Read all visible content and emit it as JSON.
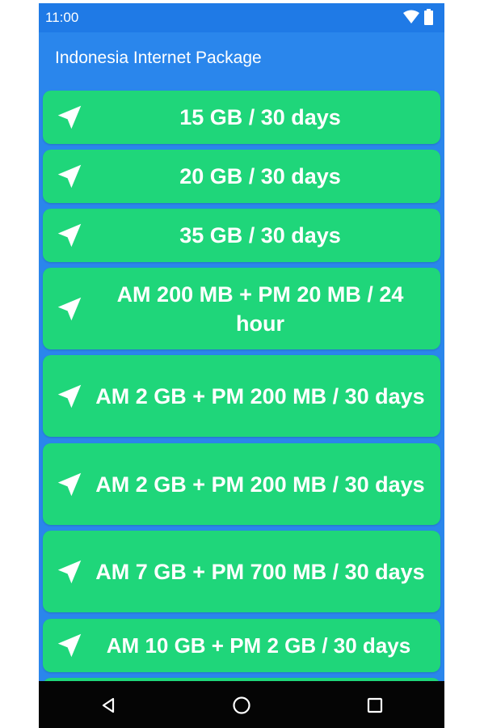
{
  "status_bar": {
    "time": "11:00",
    "icons": [
      "wifi-icon",
      "battery-icon"
    ]
  },
  "app_bar": {
    "title": "Indonesia Internet Package"
  },
  "packages": [
    {
      "label": "15 GB / 30 days"
    },
    {
      "label": "20 GB / 30 days"
    },
    {
      "label": "35 GB / 30 days"
    },
    {
      "label": "AM 200 MB + PM 20 MB / 24 hour"
    },
    {
      "label": "AM 2 GB + PM 200 MB / 30 days"
    },
    {
      "label": "AM 2 GB + PM 200 MB / 30 days"
    },
    {
      "label": "AM 7 GB + PM 700 MB / 30 days"
    },
    {
      "label": "AM 10 GB + PM 2 GB / 30 days"
    }
  ],
  "item_icon": "navigation-arrow-icon",
  "nav_bar": {
    "buttons": [
      "back-icon",
      "home-icon",
      "recents-icon"
    ]
  },
  "colors": {
    "app_bar": "#2a86ec",
    "status_bar": "#1f7ae6",
    "card": "#1fd67a",
    "text": "#ffffff",
    "nav_bar": "#050505"
  }
}
